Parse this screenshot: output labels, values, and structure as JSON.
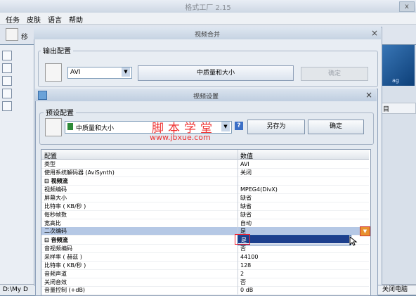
{
  "app": {
    "title": "格式工厂  2.15",
    "close": "x",
    "menu": [
      "任务",
      "皮肤",
      "语言",
      "帮助"
    ],
    "toolbar_label": "移",
    "right_panel_map_text": "ag",
    "right_panel_header": "目",
    "status_path": "D:\\My D",
    "status_right": "关闭电脑"
  },
  "merge_dialog": {
    "title": "视频合并",
    "close": "×",
    "group_label": "输出配置",
    "format_value": "AVI",
    "quality_button": "中质量和大小",
    "ok_button": "确定"
  },
  "settings_dialog": {
    "title": "视频设置",
    "close": "×",
    "preset_label": "预设配置",
    "preset_value": "中质量和大小",
    "help_glyph": "?",
    "save_as_button": "另存为",
    "ok_button": "确定",
    "watermark_line1": "脚本学堂",
    "watermark_line2": "www.jbxue.com"
  },
  "grid": {
    "col_name": "配置",
    "col_value": "数值",
    "rows": [
      {
        "name": "类型",
        "value": "AVI"
      },
      {
        "name": "使用系统解码器 (AviSynth)",
        "value": "关闭"
      },
      {
        "name": "⊟  视频流",
        "value": ""
      },
      {
        "name": "   视频编码",
        "value": "MPEG4(DivX)"
      },
      {
        "name": "   屏幕大小",
        "value": "缺省"
      },
      {
        "name": "   比特率 ( KB/秒 )",
        "value": "缺省"
      },
      {
        "name": "   每秒帧数",
        "value": "缺省"
      },
      {
        "name": "   宽高比",
        "value": "自动"
      },
      {
        "name": "   二次编码",
        "value": "是"
      },
      {
        "name": "⊟  音频流",
        "value": ""
      },
      {
        "name": "   音视频编码",
        "value": "否"
      },
      {
        "name": "   采样率 ( 赫兹 )",
        "value": "44100"
      },
      {
        "name": "   比特率 ( KB/秒 )",
        "value": "128"
      },
      {
        "name": "   音频声道",
        "value": "2"
      },
      {
        "name": "   关闭音效",
        "value": "否"
      },
      {
        "name": "   音量控制 (+dB)",
        "value": "0 dB"
      }
    ],
    "dropdown_selected": "是"
  }
}
